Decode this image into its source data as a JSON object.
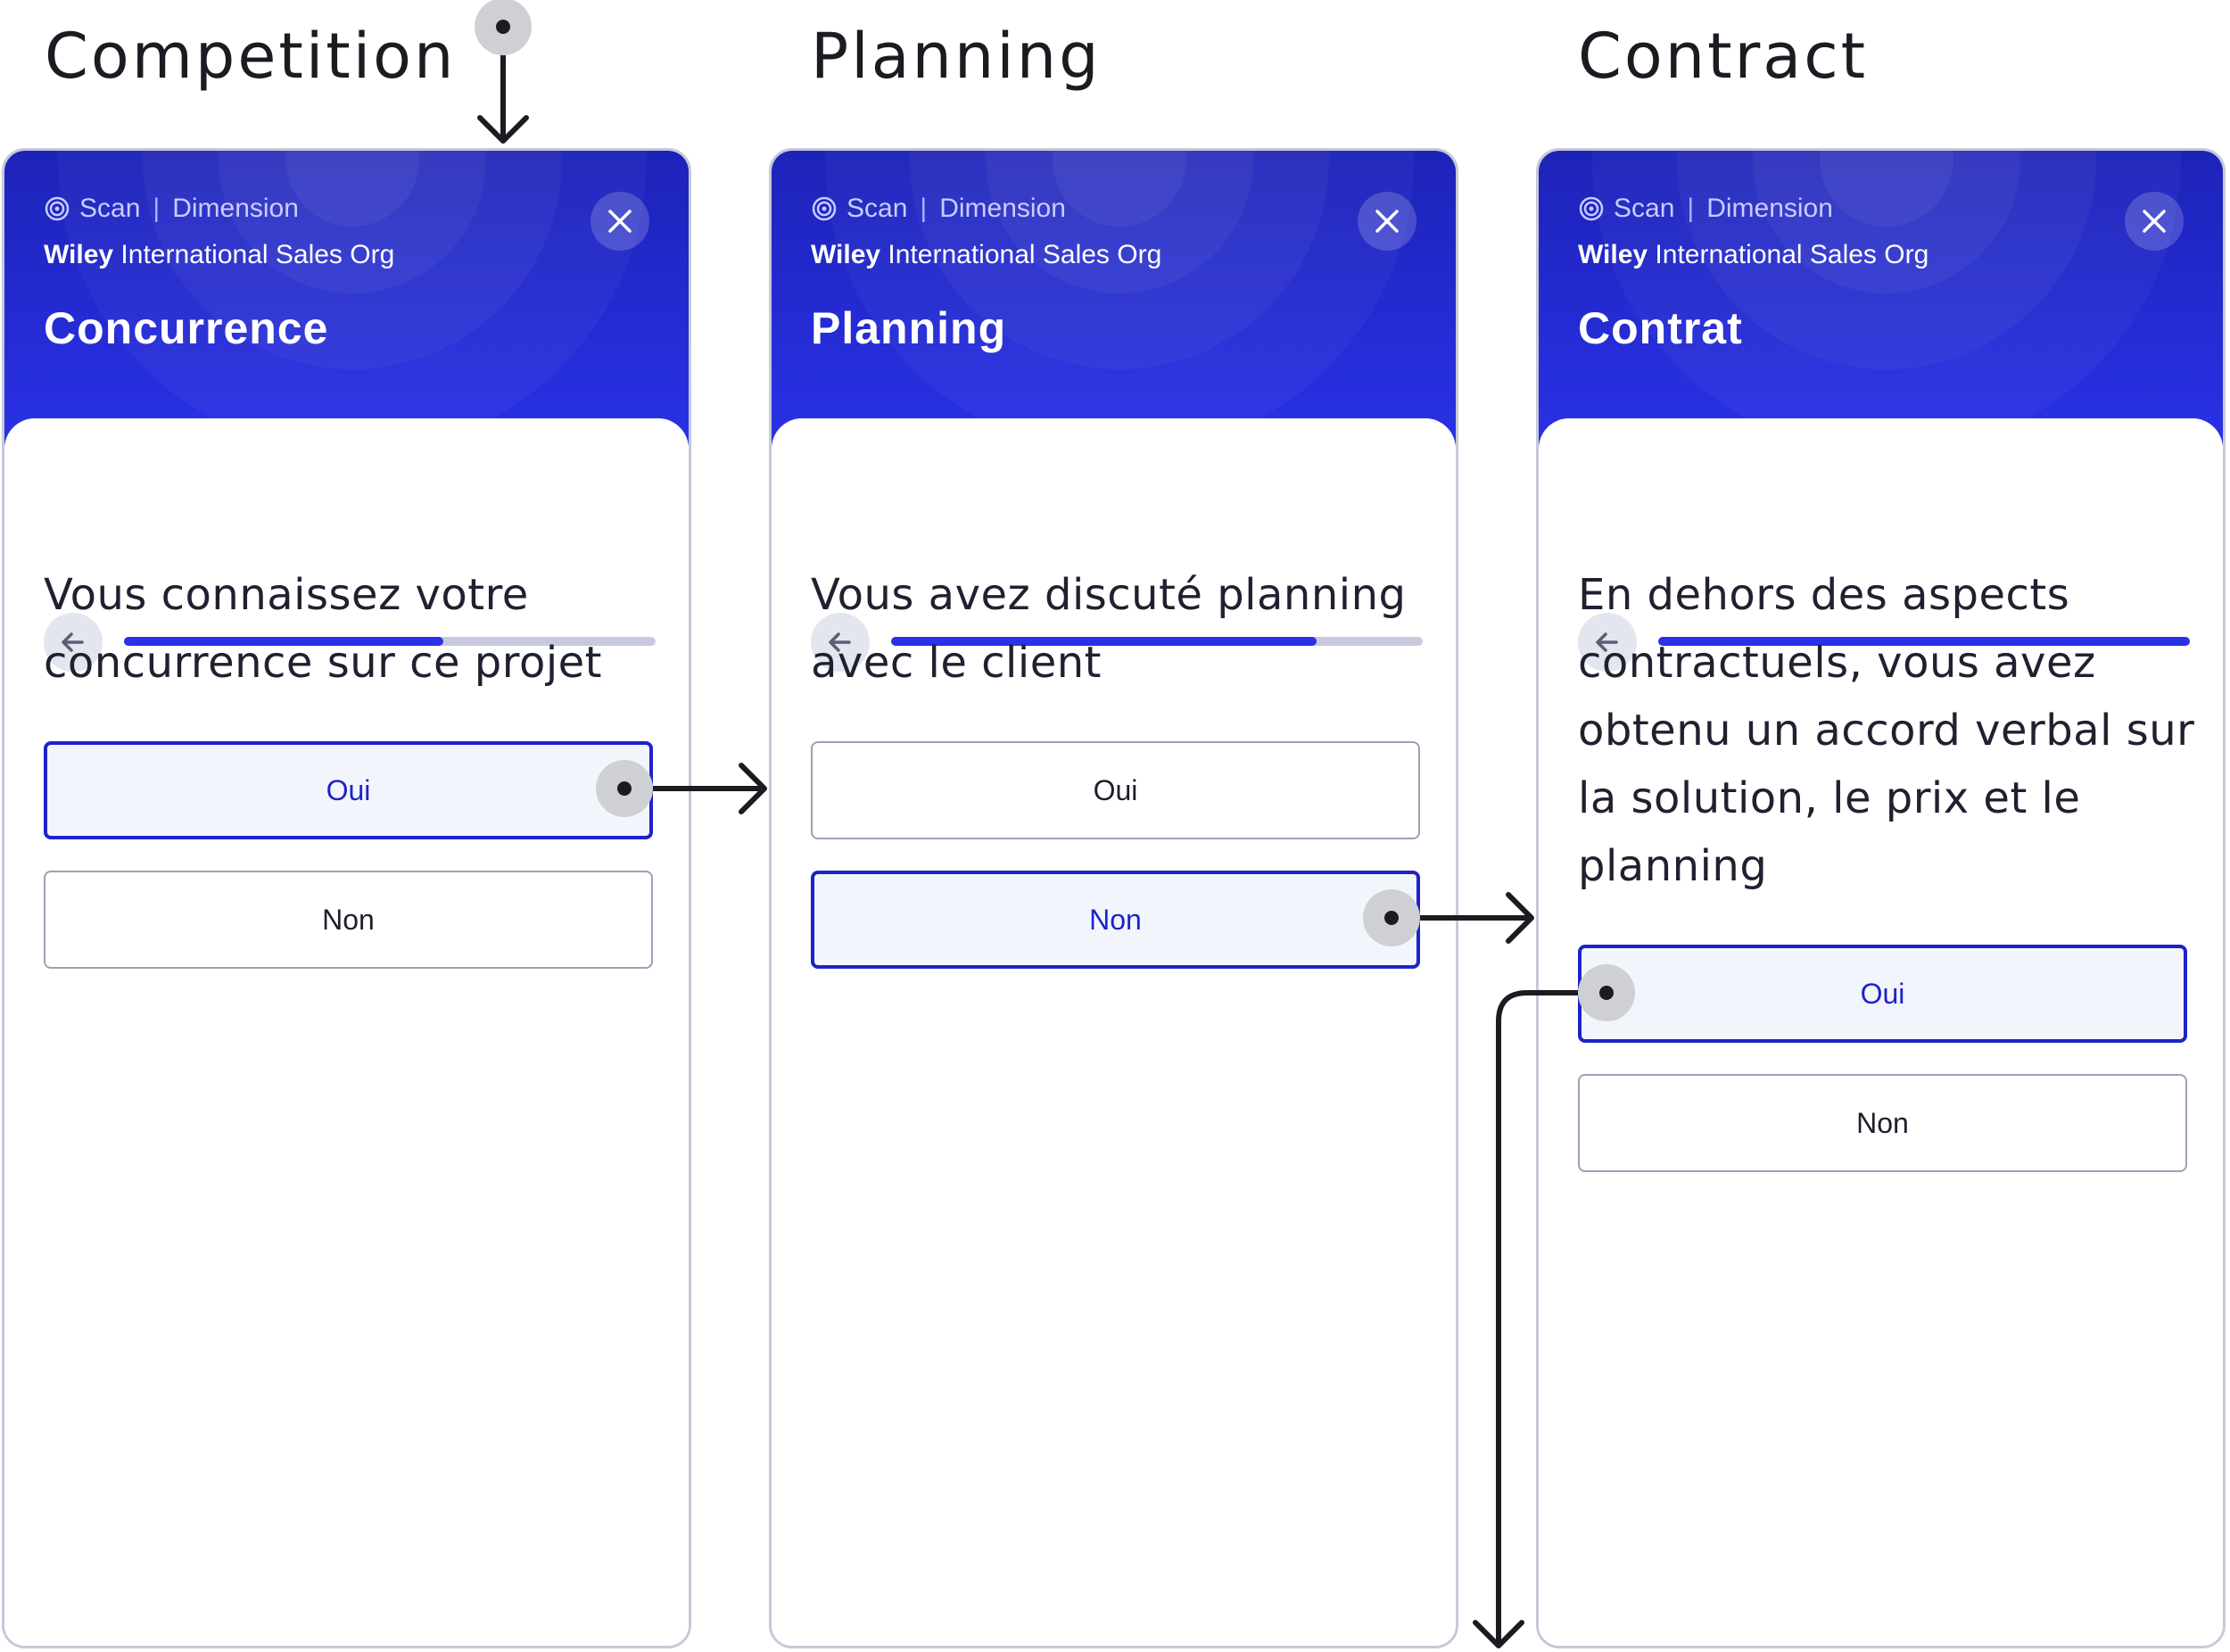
{
  "column_titles": [
    "Competition",
    "Planning",
    "Contract"
  ],
  "breadcrumb": {
    "scan": "Scan",
    "separator": "|",
    "dimension": "Dimension"
  },
  "org": {
    "bold": "Wiley",
    "rest": " International Sales Org"
  },
  "icons": {
    "scan": "scan-target-icon",
    "close": "close-icon",
    "back": "arrow-left-icon",
    "flow": "flow-arrow-icon"
  },
  "colors": {
    "header": "#2a31e6",
    "selected": "#1d23c9",
    "progress_track": "#c7cadc"
  },
  "cards": [
    {
      "title": "Concurrence",
      "progress": 0.6,
      "question": "Vous connaissez votre concurrence sur ce projet",
      "options": [
        {
          "label": "Oui",
          "selected": true
        },
        {
          "label": "Non",
          "selected": false
        }
      ]
    },
    {
      "title": "Planning",
      "progress": 0.8,
      "question": "Vous avez discuté planning avec le client",
      "options": [
        {
          "label": "Oui",
          "selected": false
        },
        {
          "label": "Non",
          "selected": true
        }
      ]
    },
    {
      "title": "Contrat",
      "progress": 1.0,
      "question": "En dehors des aspects contractuels, vous avez obtenu un accord verbal sur la solution, le prix et le planning",
      "options": [
        {
          "label": "Oui",
          "selected": true
        },
        {
          "label": "Non",
          "selected": false
        }
      ]
    }
  ]
}
